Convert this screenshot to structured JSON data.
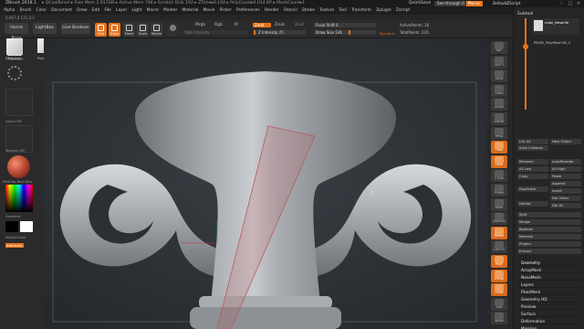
{
  "titlebar": {
    "title": "ZBrush 2018.1",
    "info": "▸ QCoolBevel ▸ Free Mem 2.917GB ▸ Active Mem 794 ▸ Scratch Disk 192 ▸ ZTime▸0.104 ▸ PolyCount▸0.014 KP ▸ MeshCount▸1",
    "quicksave": "QuickSave",
    "see_through": "See-through 0",
    "menus": "Menus",
    "default_script": "DefaultZScript"
  },
  "menubar": [
    "Alpha",
    "Brush",
    "Color",
    "Document",
    "Draw",
    "Edit",
    "File",
    "Layer",
    "Light",
    "Macro",
    "Marker",
    "Material",
    "Movie",
    "Picker",
    "Preferences",
    "Render",
    "Stencil",
    "Stroke",
    "Texture",
    "Tool",
    "Transform",
    "Zplugin",
    "Zscript"
  ],
  "coords": "0.667,0.121,0.2",
  "toolbar": {
    "home_page": "Home Page",
    "lightbox": "LightBox",
    "live_boolean": "Live Boolean",
    "edit": "Edit",
    "draw": "Draw",
    "move": "Move",
    "scale": "Scale",
    "rotate": "Rotate",
    "mrgb": "Mrgb",
    "rgb": "Rgb",
    "m": "M",
    "rgb_intensity": "Rgb Intensity",
    "zadd": "Zadd",
    "zsub": "Zsub",
    "zcut": "Zcut",
    "z_intensity": "Z Intensity",
    "z_intensity_value": "25",
    "focal_shift": "Focal Shift",
    "focal_shift_value": "0",
    "draw_size": "Draw Size",
    "draw_size_value": "136",
    "dynamic": "Dynamic",
    "active_points": "ActivePoints:",
    "active_points_value": "16",
    "total_points": "TotalPoints:",
    "total_points_value": "226"
  },
  "left": {
    "tool1": "ZModeler",
    "tool2": "PolySphere",
    "alpha": "Alpha Off",
    "texture": "Texture Off",
    "material": "MatCap Red Wax",
    "gradient": "Gradient",
    "switch_color": "SwitchColor",
    "alternate": "Alternate"
  },
  "right_shelf": [
    "Bpr",
    "SPix 3",
    "Scroll",
    "Zoom",
    "Actual",
    "AAHalf",
    "Persp",
    "Floor",
    "Local",
    "L.Sym",
    "Frame",
    "Move",
    "Zoom3D",
    "Rotate",
    "Line Fill",
    "PolyF",
    "Transp",
    "Ghost",
    "Solo",
    "Xpose"
  ],
  "panel": {
    "subtool_title": "Subtool",
    "subtool_name": "cube_NewLife",
    "subtool_name2": "PM3D_PolyMesh3D_2",
    "list_all": "List All",
    "new_folder": "New Folder",
    "auto_collapse": "Auto Collapse",
    "rename": "Rename",
    "auto_reorder": "AutoReorder",
    "all_low": "All Low",
    "all_high": "All High",
    "copy": "Copy",
    "paste": "Paste",
    "append": "Append",
    "duplicate": "Duplicate",
    "insert": "Insert",
    "del_other": "Del Other",
    "delete": "Delete",
    "del_all": "Del All",
    "split": "Split",
    "merge": "Merge",
    "boolean": "Boolean",
    "remesh": "Remesh",
    "project": "Project",
    "extract": "Extract",
    "groups": [
      "Geometry",
      "ArrayMesh",
      "NanoMesh",
      "Layers",
      "FiberMesh",
      "Geometry HD",
      "Preview",
      "Surface",
      "Deformation",
      "Masking"
    ]
  },
  "colors": {
    "accent": "#e8721a",
    "canvas_bg": "#2e3237",
    "panel_bg": "#252525"
  }
}
